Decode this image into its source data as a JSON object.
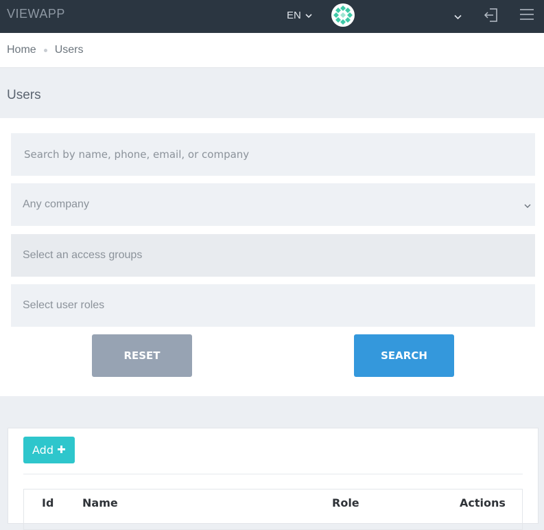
{
  "app": {
    "brand": "VIEWAPP"
  },
  "topbar": {
    "language": "EN",
    "icons": [
      "chevron-down-icon",
      "logout-icon",
      "hamburger-menu-icon"
    ]
  },
  "breadcrumb": {
    "items": [
      "Home",
      "Users"
    ]
  },
  "page": {
    "title": "Users"
  },
  "filters": {
    "search_placeholder": "Search by name, phone, email, or company",
    "company_selected": "Any company",
    "access_groups_placeholder": "Select an access groups",
    "roles_placeholder": "Select user roles",
    "reset_label": "RESET",
    "search_label": "SEARCH"
  },
  "list": {
    "add_label": "Add",
    "columns": [
      "Id",
      "Name",
      "Role",
      "Actions"
    ]
  },
  "colors": {
    "topbar": "#2b3641",
    "reset_button": "#97a3b3",
    "search_button": "#3498dc",
    "add_button": "#2ec6cc"
  }
}
